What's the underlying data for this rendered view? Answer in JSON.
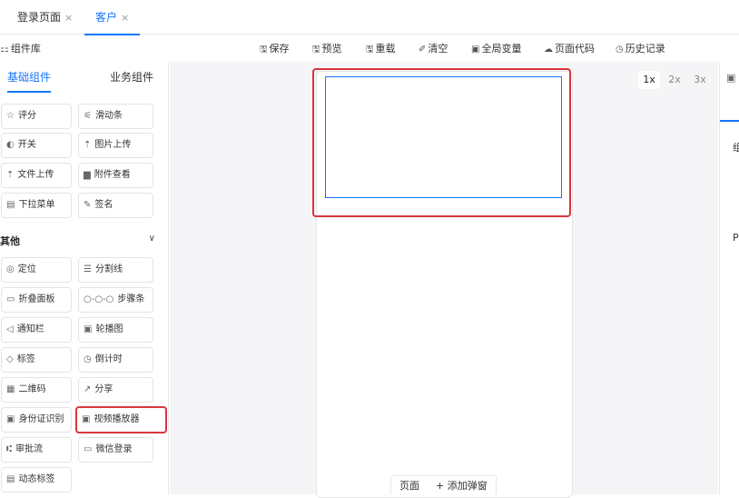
{
  "tabs": [
    {
      "label": "登录页面",
      "close": "×"
    },
    {
      "label": "客户",
      "close": "×"
    }
  ],
  "toolbar": {
    "library_icon": "⚏",
    "library_label": "组件库",
    "items": [
      {
        "icon": "🖫",
        "icon_name": "save-icon",
        "label": "保存"
      },
      {
        "icon": "🖫",
        "icon_name": "preview-icon",
        "label": "预览"
      },
      {
        "icon": "🖫",
        "icon_name": "reload-icon",
        "label": "重载"
      },
      {
        "icon": "✐",
        "icon_name": "clear-icon",
        "label": "清空"
      },
      {
        "icon": "▣",
        "icon_name": "variable-icon",
        "label": "全局变量"
      },
      {
        "icon": "☁",
        "icon_name": "cloud-icon",
        "label": "页面代码"
      },
      {
        "icon": "◷",
        "icon_name": "history-icon",
        "label": "历史记录"
      }
    ]
  },
  "left_panel": {
    "tabs": [
      "基础组件",
      "业务组件"
    ],
    "basic_components": [
      {
        "icon": "☆",
        "label": "评分"
      },
      {
        "icon": "⚟",
        "label": "滑动条"
      },
      {
        "icon": "◐",
        "label": "开关"
      },
      {
        "icon": "⇡",
        "label": "图片上传"
      },
      {
        "icon": "⇡",
        "label": "文件上传"
      },
      {
        "icon": "▆",
        "label": "附件查看"
      },
      {
        "icon": "▤",
        "label": "下拉菜单"
      },
      {
        "icon": "✎",
        "label": "签名"
      }
    ],
    "other_section": {
      "title": "其他",
      "chevron": "∨"
    },
    "other_components": [
      {
        "icon": "◎",
        "label": "定位"
      },
      {
        "icon": "☰",
        "label": "分割线"
      },
      {
        "icon": "▭",
        "label": "折叠面板"
      },
      {
        "icon": "○-○-○",
        "label": "步骤条"
      },
      {
        "icon": "◁",
        "label": "通知栏"
      },
      {
        "icon": "▣",
        "label": "轮播图"
      },
      {
        "icon": "◇",
        "label": "标签"
      },
      {
        "icon": "◷",
        "label": "倒计时"
      },
      {
        "icon": "▦",
        "label": "二维码"
      },
      {
        "icon": "↗",
        "label": "分享"
      },
      {
        "icon": "▣",
        "label": "身份证识别"
      },
      {
        "icon": "▣",
        "label": "视频播放器"
      },
      {
        "icon": "⑆",
        "label": "审批流"
      },
      {
        "icon": "▭",
        "label": "微信登录"
      },
      {
        "icon": "▤",
        "label": "动态标签"
      }
    ]
  },
  "canvas": {
    "zoom_options": [
      "1x",
      "2x",
      "3x"
    ],
    "zoom_selected": "1x",
    "bottom_tabs": [
      "页面",
      "+ 添加弹窗"
    ]
  },
  "right_panel": {
    "icon": "▣",
    "partial_texts": [
      "组",
      "P"
    ]
  }
}
